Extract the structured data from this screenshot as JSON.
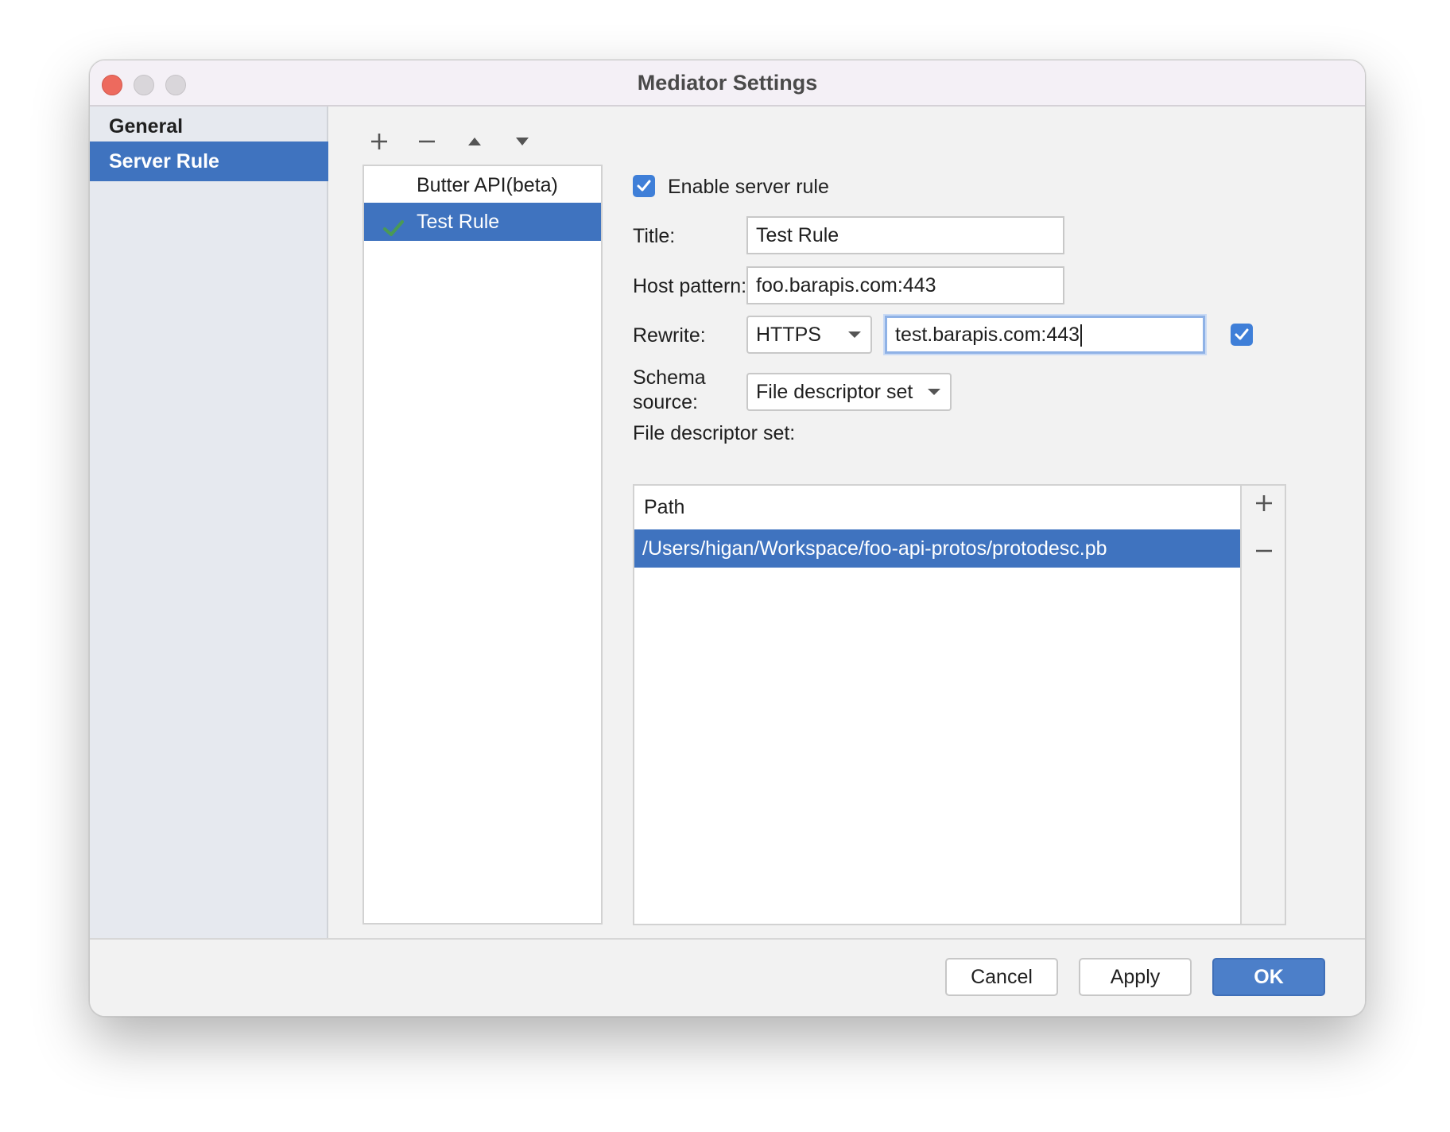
{
  "window": {
    "title": "Mediator Settings"
  },
  "sidebar": {
    "items": [
      {
        "label": "General"
      },
      {
        "label": "Server Rule",
        "selected": true
      }
    ]
  },
  "toolbar": {
    "icons": [
      "add-icon",
      "remove-icon",
      "move-up-icon",
      "move-down-icon"
    ]
  },
  "rules": {
    "items": [
      {
        "label": "Butter API(beta)"
      },
      {
        "label": "Test Rule",
        "selected": true,
        "enabled": true
      }
    ]
  },
  "form": {
    "enable_label": "Enable server rule",
    "enable_checked": true,
    "title_label": "Title:",
    "title_value": "Test Rule",
    "host_label": "Host pattern:",
    "host_value": "foo.barapis.com:443",
    "rewrite_label": "Rewrite:",
    "rewrite_scheme": "HTTPS",
    "rewrite_target": "test.barapis.com:443",
    "rewrite_checked": true,
    "schema_label_line1": "Schema",
    "schema_label_line2": "source:",
    "schema_value": "File descriptor set",
    "fds_label": "File descriptor set:"
  },
  "fds_table": {
    "header": "Path",
    "rows": [
      {
        "path": "/Users/higan/Workspace/foo-api-protos/protodesc.pb",
        "selected": true
      }
    ]
  },
  "footer": {
    "cancel": "Cancel",
    "apply": "Apply",
    "ok": "OK"
  },
  "colors": {
    "selection": "#3f73bf",
    "checkbox": "#3f7fd8",
    "check_green": "#4a9a55",
    "close": "#ed6a5e"
  }
}
